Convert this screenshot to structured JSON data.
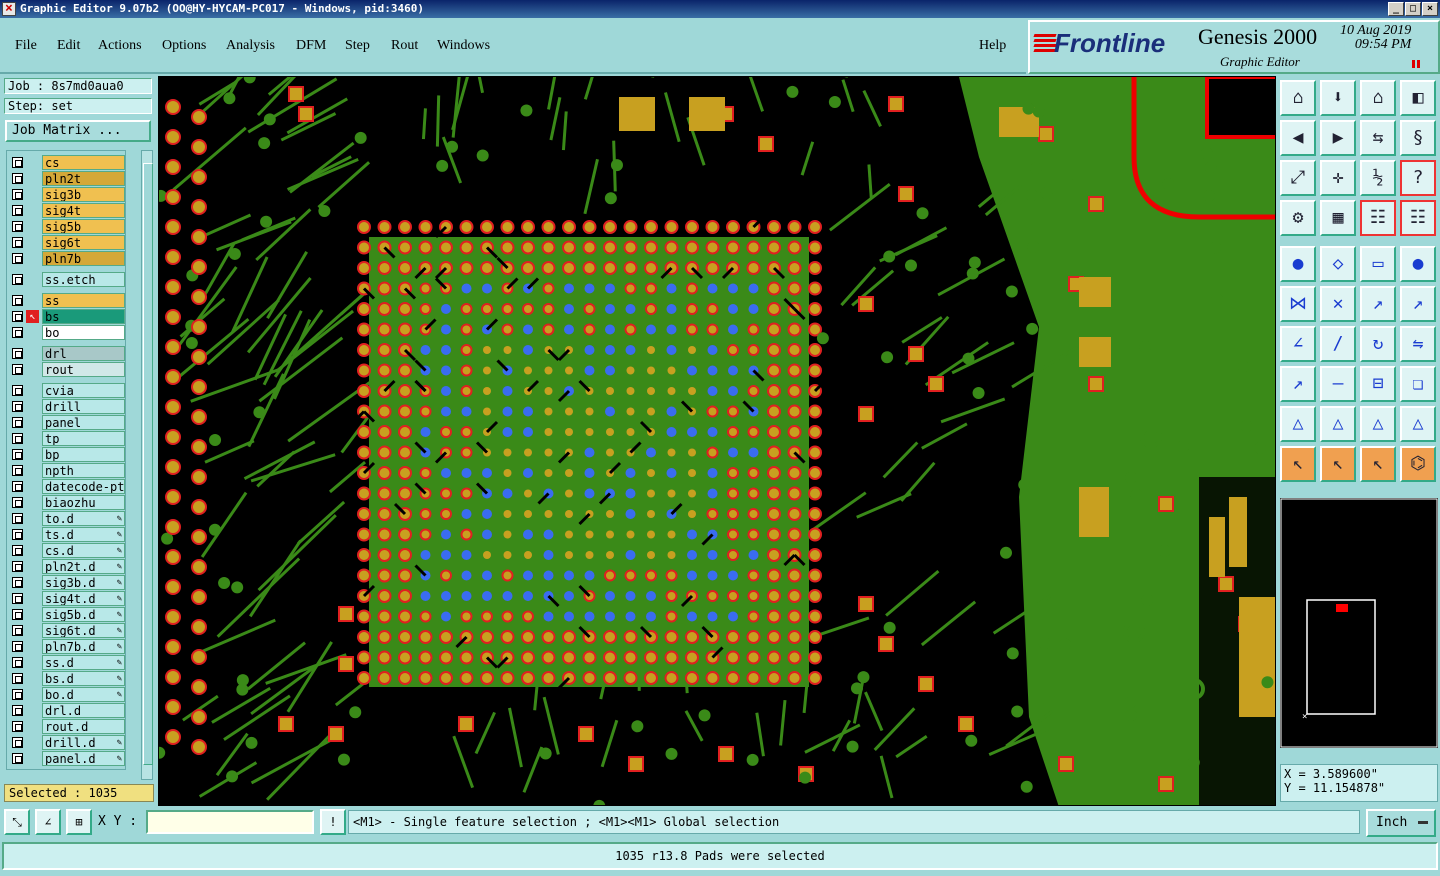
{
  "window": {
    "title": "Graphic Editor 9.07b2 (OO@HY-HYCAM-PC017 - Windows, pid:3460)",
    "controls": [
      "_",
      "□",
      "×"
    ]
  },
  "menu": {
    "items": [
      "File",
      "Edit",
      "Actions",
      "Options",
      "Analysis",
      "DFM",
      "Step",
      "Rout",
      "Windows"
    ],
    "help": "Help"
  },
  "brand": {
    "logo": "Frontline",
    "product": "Genesis 2000",
    "subtitle": "Graphic Editor",
    "date": "10 Aug 2019",
    "time": "09:54 PM"
  },
  "job": {
    "job_label": "Job : 8s7md0aua0",
    "step_label": "Step: set",
    "matrix_button": "Job Matrix ..."
  },
  "layers": [
    {
      "name": "cs",
      "color": "#f0c050"
    },
    {
      "name": "pln2t",
      "color": "#d4a838"
    },
    {
      "name": "sig3b",
      "color": "#f0c050"
    },
    {
      "name": "sig4t",
      "color": "#f0c050"
    },
    {
      "name": "sig5b",
      "color": "#f0c050"
    },
    {
      "name": "sig6t",
      "color": "#f0c050"
    },
    {
      "name": "pln7b",
      "color": "#d4a838"
    },
    {
      "name": "ss.etch",
      "color": "#b8e8e8"
    },
    {
      "name": "ss",
      "color": "#f0c050"
    },
    {
      "name": "bs",
      "color": "#1a9a7a",
      "active": true
    },
    {
      "name": "bo",
      "color": "#ffffff"
    },
    {
      "name": "drl",
      "color": "#a8c8c8"
    },
    {
      "name": "rout",
      "color": "#d0e8e8"
    },
    {
      "name": "cvia",
      "color": "#b8e8e8"
    },
    {
      "name": "drill",
      "color": "#b8e8e8"
    },
    {
      "name": "panel",
      "color": "#b8e8e8"
    },
    {
      "name": "tp",
      "color": "#b8e8e8"
    },
    {
      "name": "bp",
      "color": "#b8e8e8"
    },
    {
      "name": "npth",
      "color": "#b8e8e8"
    },
    {
      "name": "datecode-ptc",
      "color": "#b8e8e8"
    },
    {
      "name": "biaozhu",
      "color": "#b8e8e8"
    },
    {
      "name": "to.d",
      "color": "#b8e8e8",
      "mark": true
    },
    {
      "name": "ts.d",
      "color": "#b8e8e8",
      "mark": true
    },
    {
      "name": "cs.d",
      "color": "#b8e8e8",
      "mark": true
    },
    {
      "name": "pln2t.d",
      "color": "#b8e8e8",
      "mark": true
    },
    {
      "name": "sig3b.d",
      "color": "#b8e8e8",
      "mark": true
    },
    {
      "name": "sig4t.d",
      "color": "#b8e8e8",
      "mark": true
    },
    {
      "name": "sig5b.d",
      "color": "#b8e8e8",
      "mark": true
    },
    {
      "name": "sig6t.d",
      "color": "#b8e8e8",
      "mark": true
    },
    {
      "name": "pln7b.d",
      "color": "#b8e8e8",
      "mark": true
    },
    {
      "name": "ss.d",
      "color": "#b8e8e8",
      "mark": true
    },
    {
      "name": "bs.d",
      "color": "#b8e8e8",
      "mark": true
    },
    {
      "name": "bo.d",
      "color": "#b8e8e8",
      "mark": true
    },
    {
      "name": "drl.d",
      "color": "#b8e8e8"
    },
    {
      "name": "rout.d",
      "color": "#b8e8e8"
    },
    {
      "name": "drill.d",
      "color": "#b8e8e8",
      "mark": true
    },
    {
      "name": "panel.d",
      "color": "#b8e8e8",
      "mark": true
    }
  ],
  "selected_label": "Selected : 1035",
  "coords": {
    "x": "X =  3.589600\"",
    "y": "Y = 11.154878\""
  },
  "command": {
    "xy_label": "X Y :",
    "hint": "<M1> - Single feature selection ; <M1><M1> Global selection",
    "units": "Inch"
  },
  "status": "1035 r13.8 Pads were selected",
  "colors": {
    "copper": "#3a8a18",
    "pad": "#c8a020",
    "highlight": "#3a6cf0",
    "outline": "#e02020"
  }
}
